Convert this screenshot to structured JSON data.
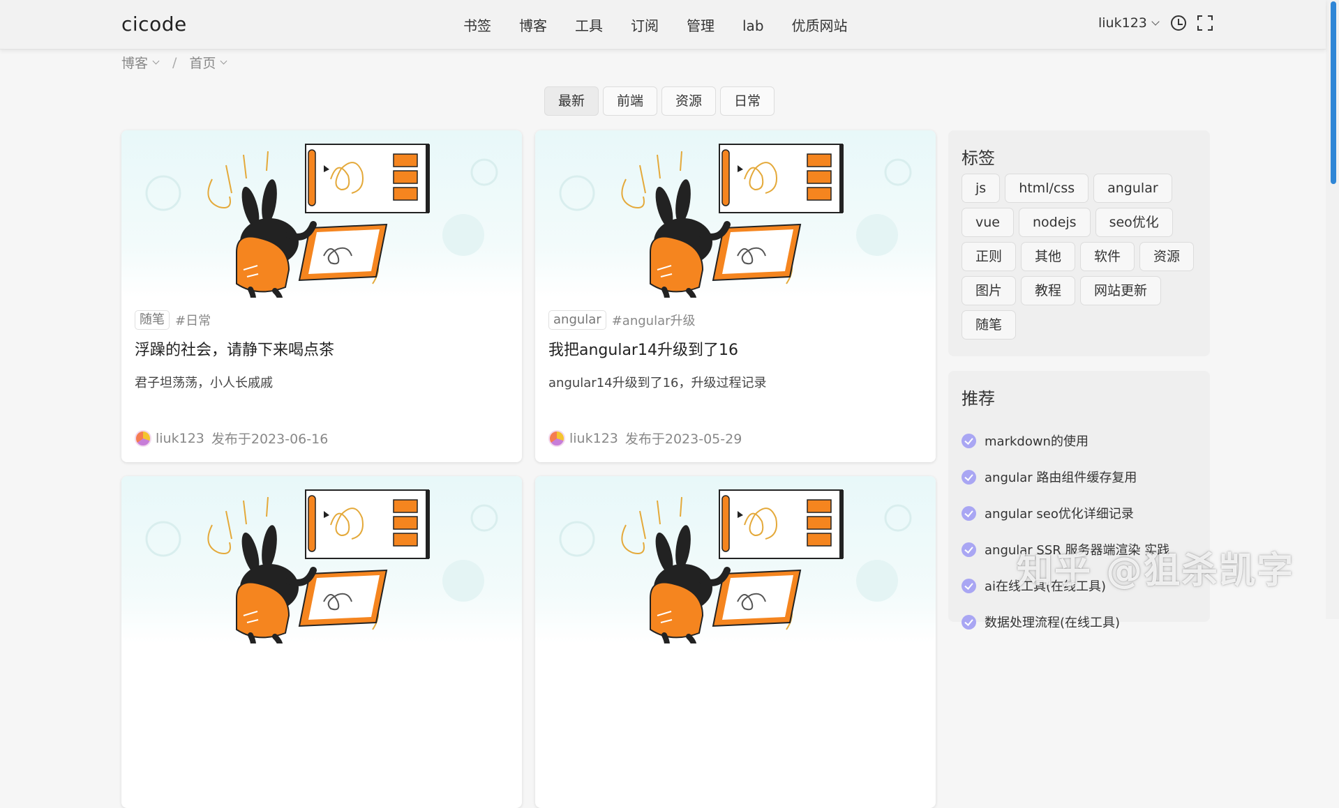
{
  "header": {
    "logo": "cicode",
    "nav": [
      "书签",
      "博客",
      "工具",
      "订阅",
      "管理",
      "lab",
      "优质网站"
    ],
    "user": "liuk123",
    "icons": [
      "clock-icon",
      "fullscreen-icon"
    ]
  },
  "breadcrumb": [
    "博客",
    "首页"
  ],
  "tabs": [
    "最新",
    "前端",
    "资源",
    "日常"
  ],
  "active_tab": "最新",
  "posts": [
    {
      "category": "随笔",
      "tag": "#日常",
      "title": "浮躁的社会，请静下来喝点茶",
      "desc": "君子坦荡荡，小人长戚戚",
      "author": "liuk123",
      "date": "发布于2023-06-16"
    },
    {
      "category": "angular",
      "tag": "#angular升级",
      "title": "我把angular14升级到了16",
      "desc": "angular14升级到了16，升级过程记录",
      "author": "liuk123",
      "date": "发布于2023-05-29"
    }
  ],
  "sidebar": {
    "tags_title": "标签",
    "tags": [
      "js",
      "html/css",
      "angular",
      "vue",
      "nodejs",
      "seo优化",
      "正则",
      "其他",
      "软件",
      "资源",
      "图片",
      "教程",
      "网站更新",
      "随笔"
    ],
    "rec_title": "推荐",
    "recommended": [
      "markdown的使用",
      "angular 路由组件缓存复用",
      "angular seo优化详细记录",
      "angular SSR 服务器端渲染 实践",
      "ai在线工具(在线工具)",
      "数据处理流程(在线工具)"
    ]
  },
  "watermark": "知乎 @狙杀凯字",
  "colors": {
    "accent_scroll": "#2f86d6",
    "check": "#a9a6f3",
    "illustration_orange": "#f5851f"
  }
}
